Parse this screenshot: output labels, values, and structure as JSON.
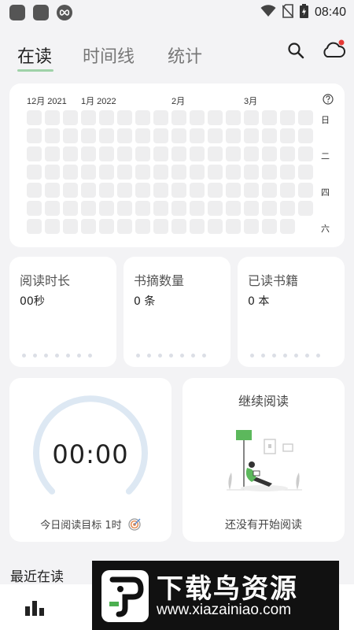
{
  "status_bar": {
    "time": "08:40",
    "icons": [
      "app-icon",
      "app-icon",
      "infinity-icon",
      "wifi-icon",
      "no-sim-icon",
      "battery-icon"
    ]
  },
  "tabs": [
    {
      "label": "在读",
      "active": true
    },
    {
      "label": "时间线",
      "active": false
    },
    {
      "label": "统计",
      "active": false
    }
  ],
  "header_icons": [
    "search-icon",
    "cloud-sync-icon"
  ],
  "heatmap": {
    "months": [
      "12月 2021",
      "1月 2022",
      "2月",
      "3月"
    ],
    "weekday_labels": [
      "日",
      "",
      "二",
      "",
      "四",
      "",
      "六"
    ],
    "columns": 16,
    "rows": 7,
    "last_column_rows": 6,
    "help_icon": "help-circle-icon"
  },
  "stats": [
    {
      "title": "阅读时长",
      "value": "00秒"
    },
    {
      "title": "书摘数量",
      "value": "0 条"
    },
    {
      "title": "已读书籍",
      "value": "0 本"
    }
  ],
  "timer": {
    "time": "00:00",
    "goal": "今日阅读目标 1时",
    "goal_icon": "target-icon"
  },
  "continue_reading": {
    "title": "继续阅读",
    "empty_text": "还没有开始阅读"
  },
  "recent": {
    "title": "最近在读"
  },
  "bottom_nav": {
    "icon": "bar-chart-icon"
  },
  "watermark": {
    "title": "下载鸟资源",
    "url": "www.xiazainiao.com"
  },
  "colors": {
    "background": "#f3f3f5",
    "card": "#ffffff",
    "tab_indicator": "#9fd2a8",
    "cell_empty": "#eeeeef",
    "ring": "#dde8f3",
    "accent_green": "#5cb85c",
    "notification": "#e53935"
  }
}
